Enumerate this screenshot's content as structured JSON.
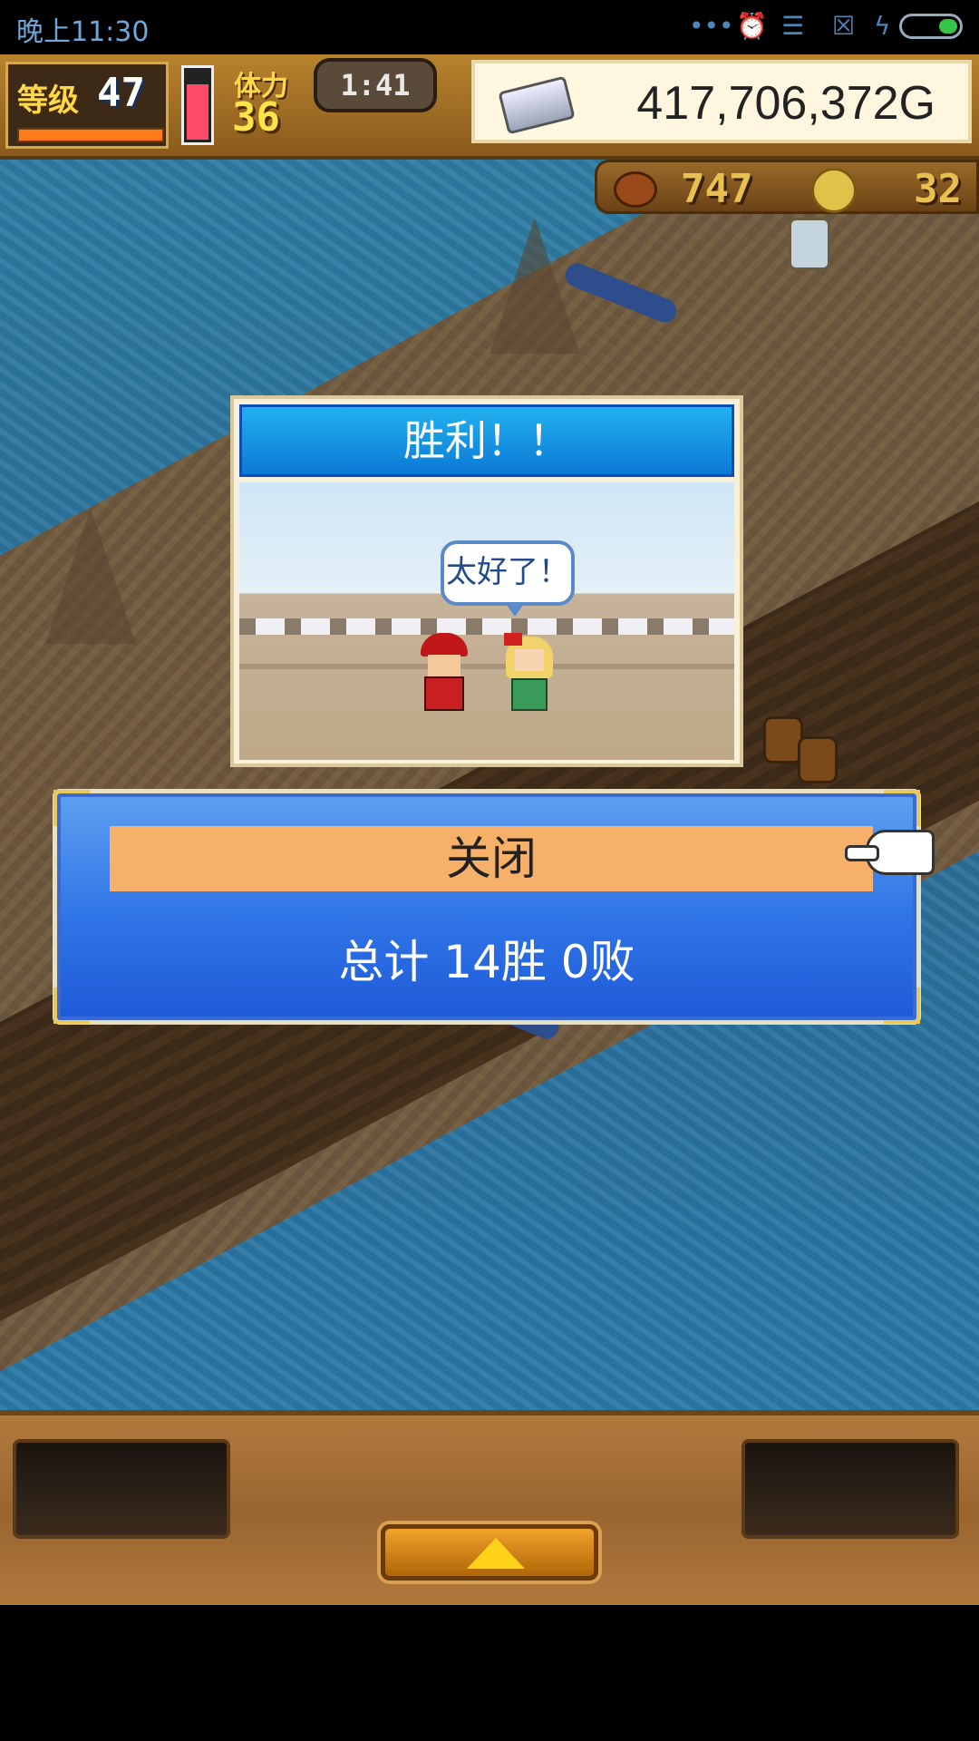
{
  "status_bar": {
    "time": "晚上11:30",
    "icons": [
      "more-dots-icon",
      "alarm-icon",
      "wifi-icon",
      "no-sim-icon",
      "charging-icon",
      "battery-icon"
    ],
    "battery_level": 0.35
  },
  "hud": {
    "level_label": "等级",
    "level_value": "47",
    "exp_fraction": 1.0,
    "stamina_fraction": 0.8,
    "stamina_label": "体力",
    "stamina_value": "36",
    "timer": "1:41",
    "money_icon": "silver-bar-icon",
    "money": "417,706,372G",
    "food_icon": "meat-icon",
    "food_value": "747",
    "medal_icon": "gold-medal-icon",
    "medal_value": "32"
  },
  "victory": {
    "title": "胜利！！",
    "speech": "太好了！"
  },
  "result": {
    "close_label": "关闭",
    "record": "总计 14胜 0败"
  },
  "colors": {
    "accent_blue": "#2f74e6",
    "close_button": "#f6b06a",
    "victory_header": "#0b7ad6",
    "hud_wood": "#8a5a1c"
  }
}
